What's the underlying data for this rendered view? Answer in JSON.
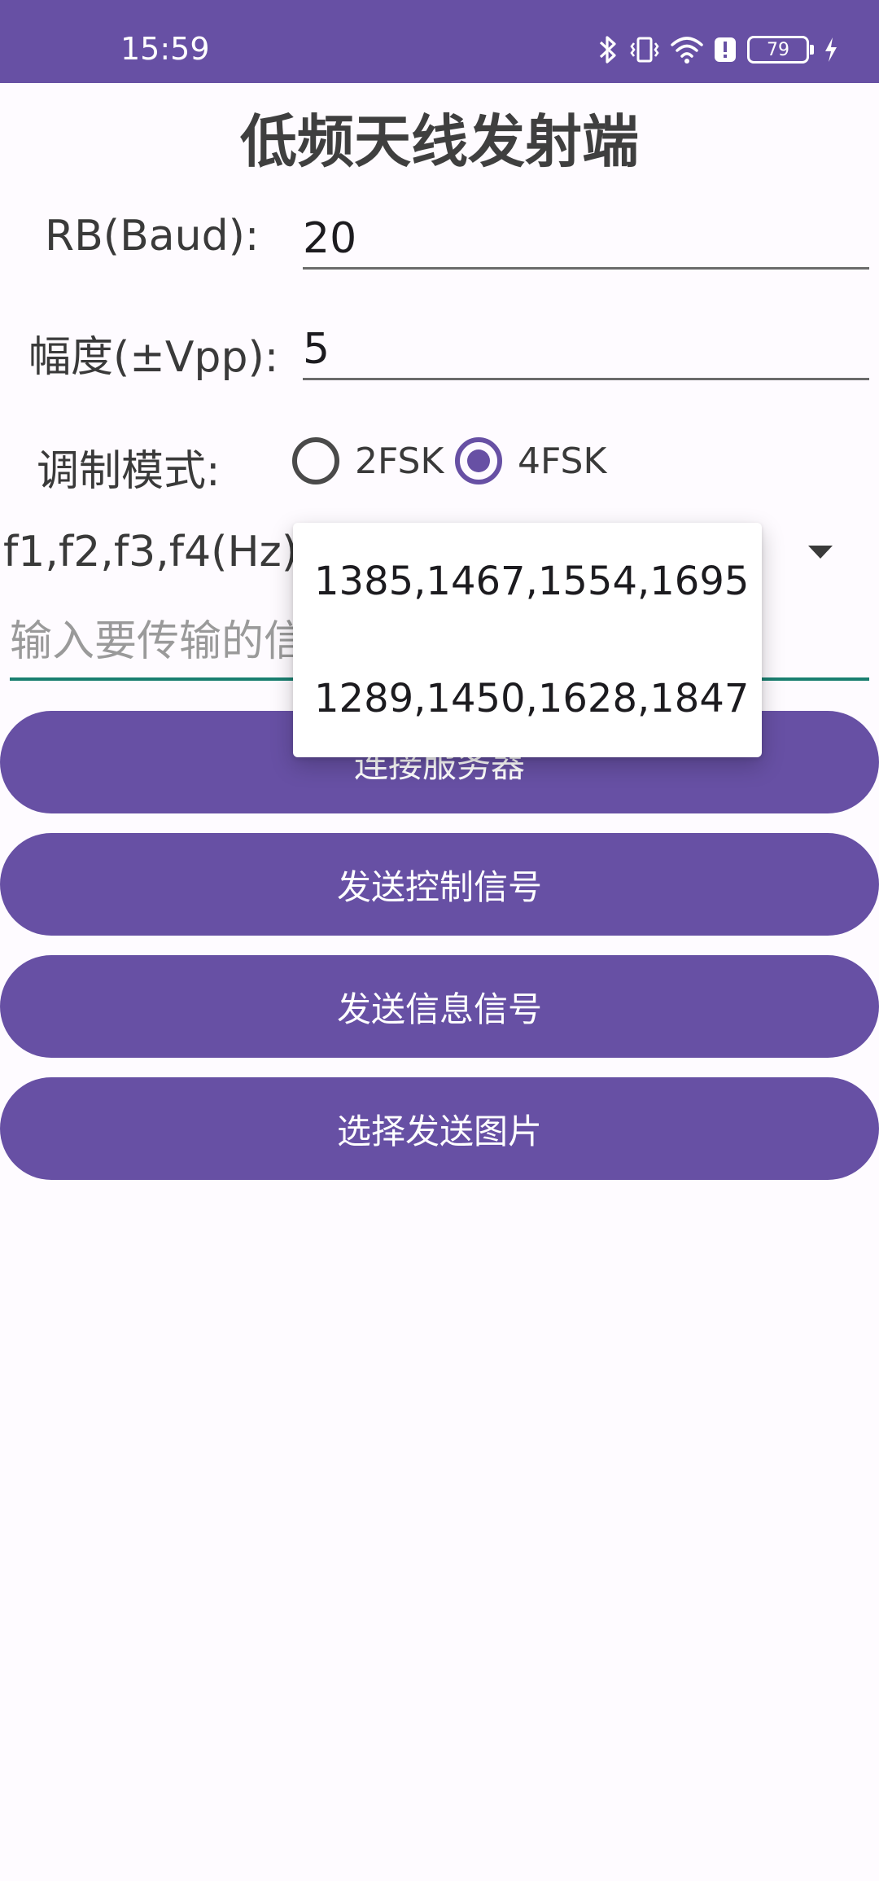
{
  "status_bar": {
    "time": "15:59",
    "battery_level": "79",
    "icons": [
      "bluetooth-icon",
      "vibrate-icon",
      "wifi-icon",
      "alert-icon",
      "battery-icon",
      "charging-icon"
    ]
  },
  "header": {
    "title": "低频天线发射端"
  },
  "form": {
    "rb_label": "RB(Baud):",
    "rb_value": "20",
    "amplitude_label": "幅度(±Vpp):",
    "amplitude_value": "5",
    "modulation_label": "调制模式:",
    "modulation_options": [
      {
        "label": "2FSK",
        "checked": false
      },
      {
        "label": "4FSK",
        "checked": true
      }
    ],
    "freq_label": "f1,f2,f3,f4(Hz):",
    "message_placeholder": "输入要传输的信"
  },
  "buttons": {
    "connect": "连接服务器",
    "send_control": "发送控制信号",
    "send_info": "发送信息信号",
    "select_image": "选择发送图片"
  },
  "freq_dropdown": {
    "options": [
      "1385,1467,1554,1695",
      "1289,1450,1628,1847"
    ]
  },
  "colors": {
    "primary": "#6750a4",
    "focus_underline": "#1a7f70",
    "background": "#fefbff"
  }
}
